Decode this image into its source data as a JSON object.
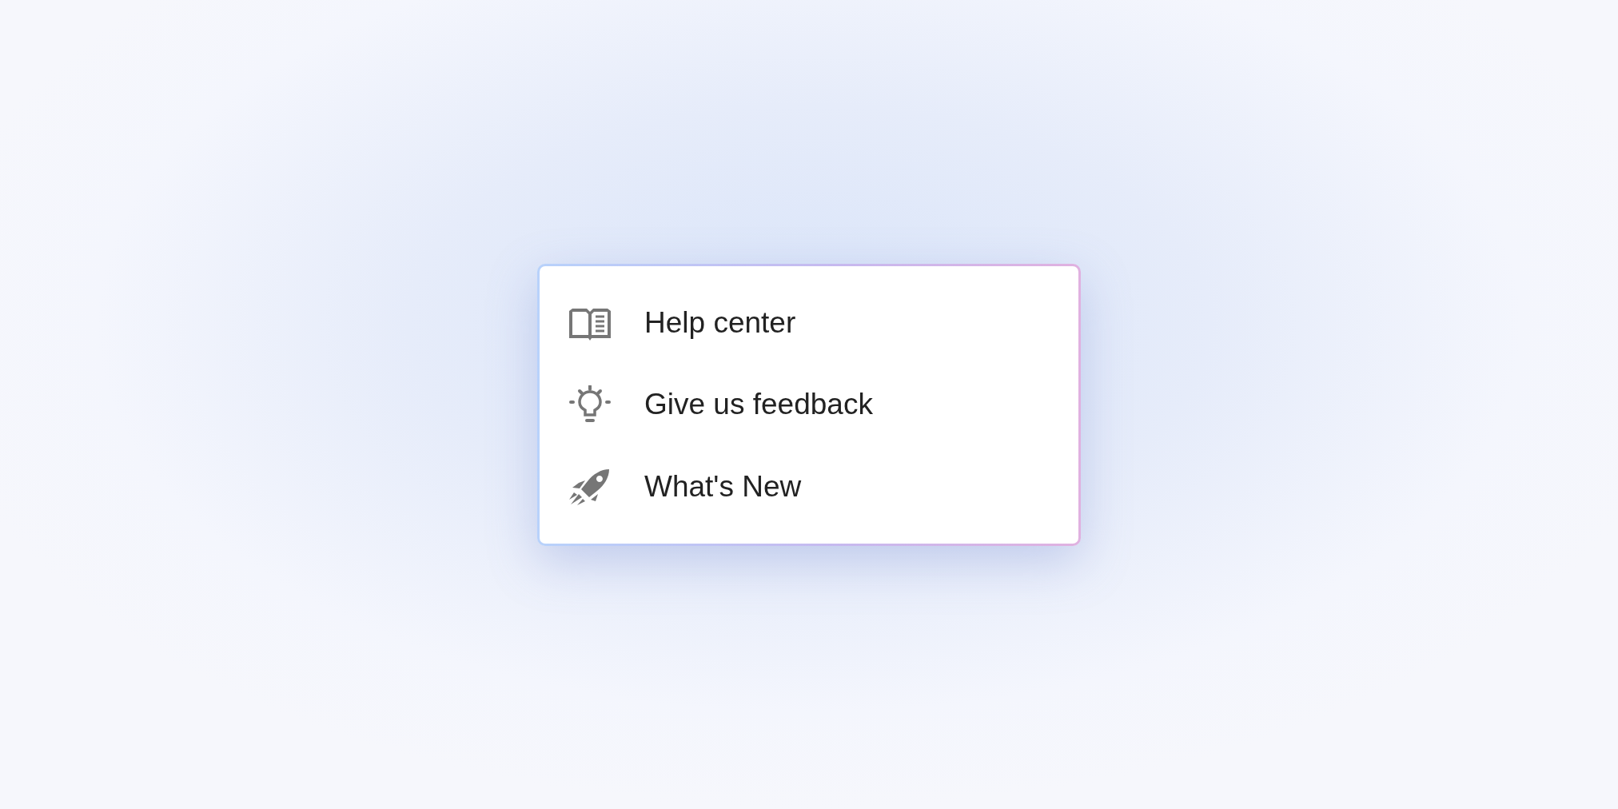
{
  "menu": {
    "items": [
      {
        "label": "Help center"
      },
      {
        "label": "Give us feedback"
      },
      {
        "label": "What's New"
      }
    ]
  }
}
